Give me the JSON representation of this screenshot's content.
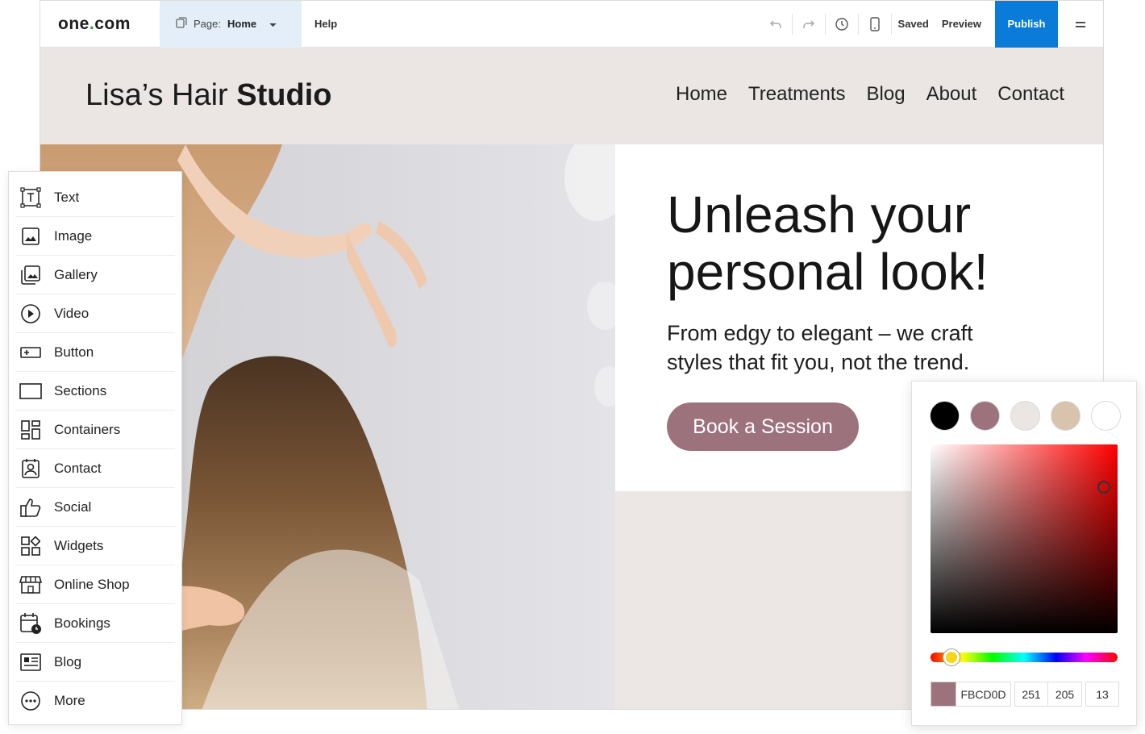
{
  "topbar": {
    "logo_text": "one",
    "logo_dot": ".",
    "logo_suffix": "com",
    "page_label": "Page:",
    "page_value": "Home",
    "help": "Help",
    "saved": "Saved",
    "preview": "Preview",
    "publish": "Publish"
  },
  "site": {
    "brand_light": "Lisa’s Hair ",
    "brand_bold": "Studio",
    "nav": [
      "Home",
      "Treatments",
      "Blog",
      "About",
      "Contact"
    ],
    "headline": "Unleash your personal look!",
    "subline": "From edgy to elegant – we craft styles that fit you, not the trend.",
    "cta": "Book a Session"
  },
  "panel": {
    "items": [
      {
        "label": "Text",
        "icon": "text-icon"
      },
      {
        "label": "Image",
        "icon": "image-icon"
      },
      {
        "label": "Gallery",
        "icon": "gallery-icon"
      },
      {
        "label": "Video",
        "icon": "video-icon"
      },
      {
        "label": "Button",
        "icon": "button-icon"
      },
      {
        "label": "Sections",
        "icon": "sections-icon"
      },
      {
        "label": "Containers",
        "icon": "containers-icon"
      },
      {
        "label": "Contact",
        "icon": "contact-icon"
      },
      {
        "label": "Social",
        "icon": "social-icon"
      },
      {
        "label": "Widgets",
        "icon": "widgets-icon"
      },
      {
        "label": "Online Shop",
        "icon": "shop-icon"
      },
      {
        "label": "Bookings",
        "icon": "bookings-icon"
      },
      {
        "label": "Blog",
        "icon": "blog-icon"
      },
      {
        "label": "More",
        "icon": "more-icon"
      }
    ]
  },
  "picker": {
    "swatches": [
      "#000000",
      "#9c727d",
      "#ebe6e3",
      "#d8c3ad",
      "#ffffff"
    ],
    "preview_color": "#9c727d",
    "hex": "FBCD0D",
    "r": "251",
    "g": "205",
    "b": "13"
  },
  "colors": {
    "accent": "#0a7bd8",
    "brand_mauve": "#9c727d",
    "header_bg": "#ebe6e3"
  }
}
